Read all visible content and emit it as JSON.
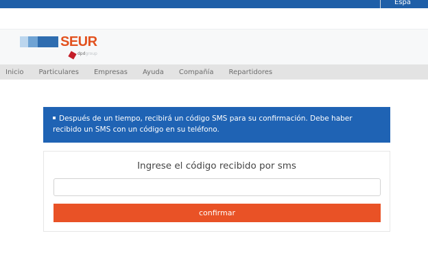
{
  "topbar": {
    "language_label": "Espa"
  },
  "brand": {
    "name": "SEUR",
    "sub_prefix": "dpd",
    "sub_suffix": "group"
  },
  "nav": {
    "items": [
      "Inicio",
      "Particulares",
      "Empresas",
      "Ayuda",
      "Compañía",
      "Repartidores"
    ]
  },
  "info": {
    "message": "Después de un tiempo, recibirá un código SMS para su confirmación. Debe haber recibido un SMS con un código en su teléfono."
  },
  "form": {
    "title": "Ingrese el código recibido por sms",
    "code_value": "",
    "confirm_label": "confirmar"
  },
  "colors": {
    "topbar": "#1f5fa8",
    "info_bg": "#1f63b4",
    "button_bg": "#e95226",
    "brand_orange": "#e2511e"
  }
}
